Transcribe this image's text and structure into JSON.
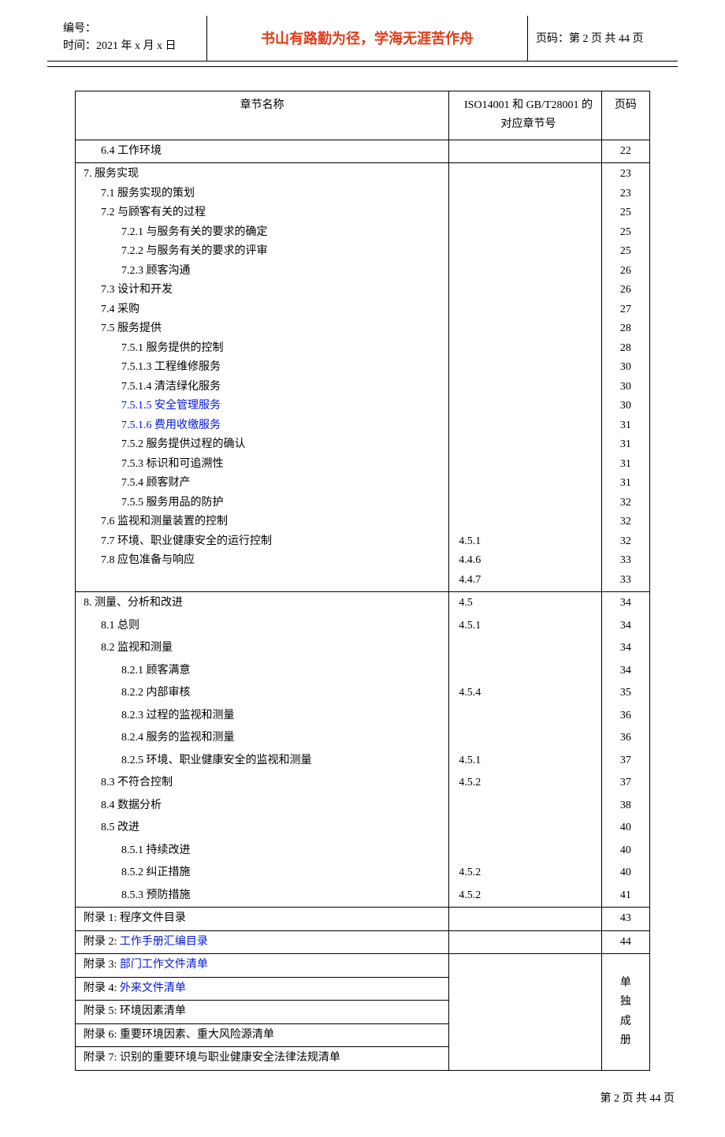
{
  "header": {
    "number_label": "编号：",
    "time_label": "时间：2021 年 x 月 x 日",
    "motto": "书山有路勤为径，学海无涯苦作舟",
    "page_label": "页码：第 2 页  共 44 页"
  },
  "toc_header": {
    "name": "章节名称",
    "ref": "ISO14001 和 GB/T28001 的对应章节号",
    "page": "页码"
  },
  "sections": [
    {
      "type": "row-sep",
      "lv": 1,
      "name": "6.4 工作环境",
      "ref": "",
      "page": "22"
    },
    {
      "type": "group-start"
    },
    {
      "lv": 0,
      "name": "7. 服务实现",
      "page": "23"
    },
    {
      "lv": 1,
      "name": "7.1 服务实现的策划",
      "page": "23"
    },
    {
      "lv": 1,
      "name": "7.2 与顾客有关的过程",
      "page": "25"
    },
    {
      "lv": 2,
      "name": "7.2.1 与服务有关的要求的确定",
      "page": "25"
    },
    {
      "lv": 2,
      "name": "7.2.2 与服务有关的要求的评审",
      "page": "25"
    },
    {
      "lv": 2,
      "name": "7.2.3 顾客沟通",
      "page": "26"
    },
    {
      "lv": 1,
      "name": "7.3 设计和开发",
      "page": "26"
    },
    {
      "lv": 1,
      "name": "7.4 采购",
      "page": "27"
    },
    {
      "lv": 1,
      "name": "7.5 服务提供",
      "page": "28"
    },
    {
      "lv": 2,
      "name": "7.5.1 服务提供的控制",
      "page": "28"
    },
    {
      "lv": 2,
      "name": "7.5.1.3 工程维修服务",
      "page": "30"
    },
    {
      "lv": 2,
      "name": "7.5.1.4 清洁绿化服务",
      "page": "30"
    },
    {
      "lv": 2,
      "name": "7.5.1.5 安全管理服务",
      "link": true,
      "page": "30"
    },
    {
      "lv": 2,
      "name": "7.5.1.6 费用收缴服务",
      "link": true,
      "page": "31"
    },
    {
      "lv": 2,
      "name": "7.5.2 服务提供过程的确认",
      "page": "31"
    },
    {
      "lv": 2,
      "name": "7.5.3 标识和可追溯性",
      "page": "31"
    },
    {
      "lv": 2,
      "name": "7.5.4 顾客财产",
      "page": "31"
    },
    {
      "lv": 2,
      "name": "7.5.5 服务用品的防护",
      "page": "32"
    },
    {
      "lv": 1,
      "name": "7.6 监视和测量装置的控制",
      "page": "32"
    },
    {
      "lv": 1,
      "name": "7.7 环境、职业健康安全的运行控制",
      "ref": "4.5.1",
      "page": "32"
    },
    {
      "lv": 1,
      "name": "7.8 应包准备与响应",
      "ref": "4.4.6",
      "page": "33"
    },
    {
      "type": "group-end",
      "ref": "4.4.7",
      "page": "33"
    },
    {
      "lv": 0,
      "name": "8. 测量、分析和改进",
      "ref": "4.5",
      "page": "34"
    },
    {
      "lv": 1,
      "name": "8.1 总则",
      "ref": "4.5.1",
      "page": "34"
    },
    {
      "lv": 1,
      "name": "8.2 监视和测量",
      "page": "34"
    },
    {
      "lv": 2,
      "name": "8.2.1 顾客满意",
      "page": "34"
    },
    {
      "lv": 2,
      "name": "8.2.2 内部审核",
      "ref": "4.5.4",
      "page": "35"
    },
    {
      "lv": 2,
      "name": "8.2.3 过程的监视和测量",
      "page": "36"
    },
    {
      "lv": 2,
      "name": "8.2.4 服务的监视和测量",
      "page": "36"
    },
    {
      "lv": 2,
      "name": "8.2.5 环境、职业健康安全的监视和测量",
      "ref": "4.5.1",
      "page": "37"
    },
    {
      "lv": 1,
      "name": "8.3 不符合控制",
      "ref": "4.5.2",
      "page": "37"
    },
    {
      "lv": 1,
      "name": "8.4 数据分析",
      "page": "38"
    },
    {
      "lv": 1,
      "name": "8.5 改进",
      "page": "40"
    },
    {
      "lv": 2,
      "name": "8.5.1 持续改进",
      "page": "40"
    },
    {
      "lv": 2,
      "name": "8.5.2 纠正措施",
      "ref": "4.5.2",
      "page": "40"
    },
    {
      "type": "row-sep",
      "lv": 2,
      "name": "8.5.3 预防措施",
      "ref": "4.5.2",
      "page": "41"
    },
    {
      "type": "row-sep",
      "lv": 0,
      "name_prefix": "附录 1:",
      "name_rest": "程序文件目录",
      "page": "43"
    },
    {
      "type": "row-sep",
      "lv": 0,
      "name_prefix": "附录 2:",
      "name_rest": "工作手册汇编目录",
      "rest_link": true,
      "page": "44"
    }
  ],
  "appendix_block": {
    "rows": [
      {
        "prefix": "附录 3:",
        "rest": "部门工作文件清单",
        "rest_link": true
      },
      {
        "prefix": "附录 4:",
        "rest": "外来文件清单",
        "rest_link": true
      },
      {
        "prefix": "附录 5:",
        "rest": "环境因素清单"
      },
      {
        "prefix": "附录 6:",
        "rest": "重要环境因素、重大风险源清单"
      },
      {
        "prefix": "附录 7:",
        "rest": "识别的重要环境与职业健康安全法律法规清单"
      }
    ],
    "page_text": "单独成册"
  },
  "footer": "第 2 页 共 44 页"
}
